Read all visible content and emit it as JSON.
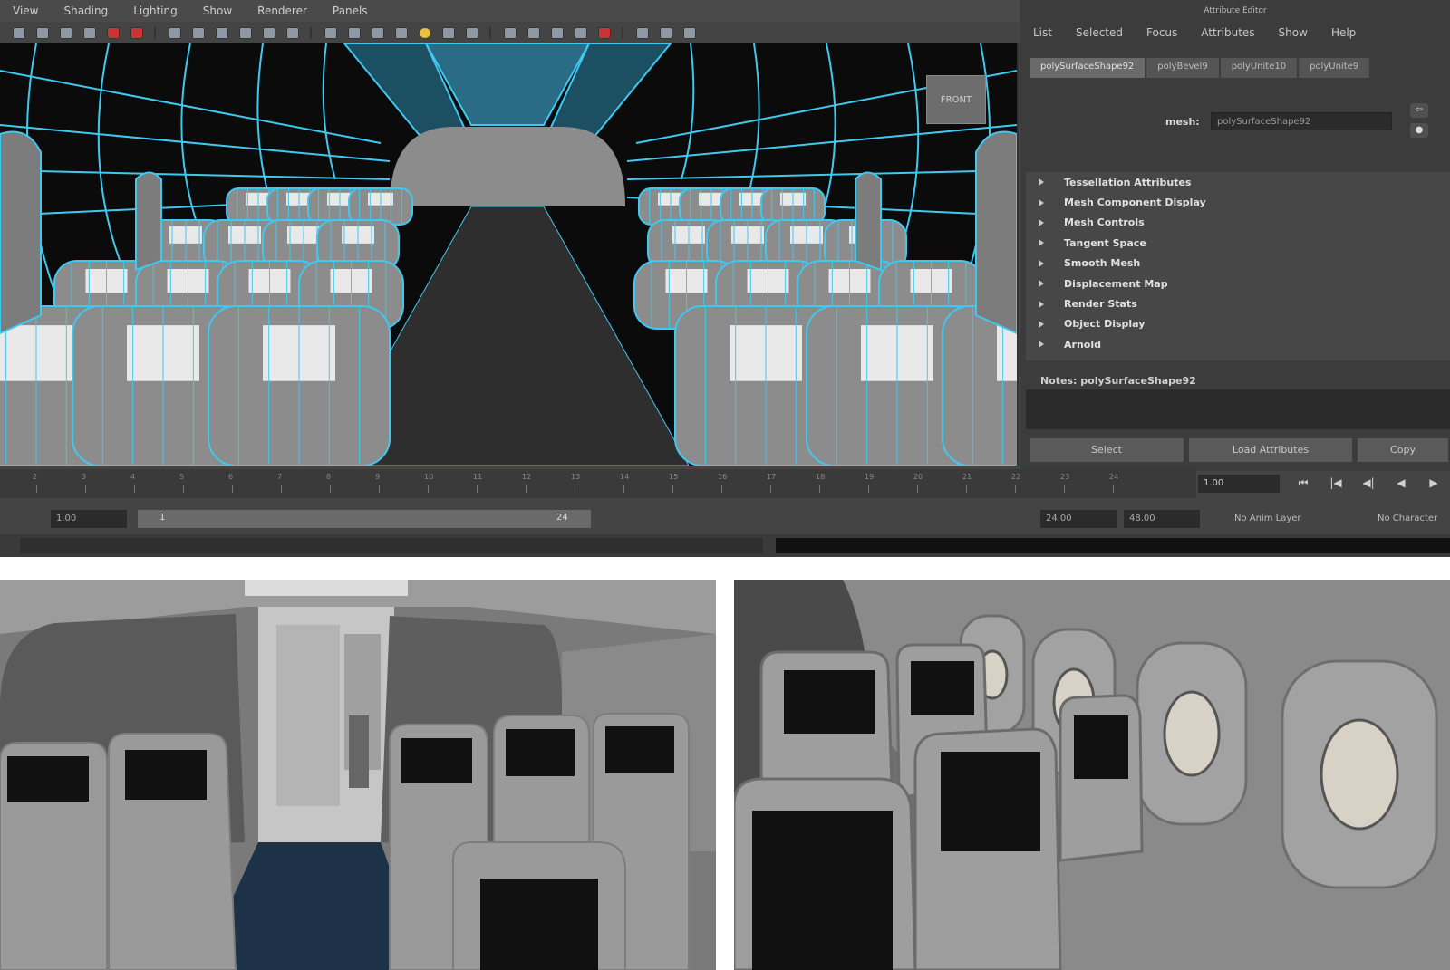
{
  "maya": {
    "menubar": [
      "View",
      "Shading",
      "Lighting",
      "Show",
      "Renderer",
      "Panels"
    ],
    "viewport": {
      "view_cube_label": "FRONT"
    },
    "attribute_editor": {
      "title": "Attribute Editor",
      "menu": [
        "List",
        "Selected",
        "Focus",
        "Attributes",
        "Show",
        "Help"
      ],
      "tabs": [
        "polySurfaceShape92",
        "polyBevel9",
        "polyUnite10",
        "polyUnite9"
      ],
      "mesh_label": "mesh:",
      "mesh_value": "polySurfaceShape92",
      "sections": [
        "Tessellation Attributes",
        "Mesh Component Display",
        "Mesh Controls",
        "Tangent Space",
        "Smooth Mesh",
        "Displacement Map",
        "Render Stats",
        "Object Display",
        "Arnold"
      ],
      "notes_label": "Notes: polySurfaceShape92",
      "buttons": [
        "Select",
        "Load Attributes",
        "Copy"
      ]
    },
    "time_slider": {
      "ticks": [
        "2",
        "3",
        "4",
        "5",
        "6",
        "7",
        "8",
        "9",
        "10",
        "11",
        "12",
        "13",
        "14",
        "15",
        "16",
        "17",
        "18",
        "19",
        "20",
        "21",
        "22",
        "23",
        "24"
      ],
      "current_time": "1.00",
      "play_controls": [
        "⏮",
        "|◀",
        "◀|",
        "◀",
        "▶"
      ]
    },
    "range_slider": {
      "start": "1.00",
      "inner_start": "1",
      "inner_end": "24",
      "end": "24.00",
      "anim_end": "48.00",
      "anim_layer": "No Anim Layer",
      "character": "No Character"
    }
  },
  "colors": {
    "wireframe": "#3fc8f0",
    "seat_gray": "#8c8c8c",
    "viewport_bg": "#0b0b0b",
    "ui_dark": "#3c3c3c"
  }
}
